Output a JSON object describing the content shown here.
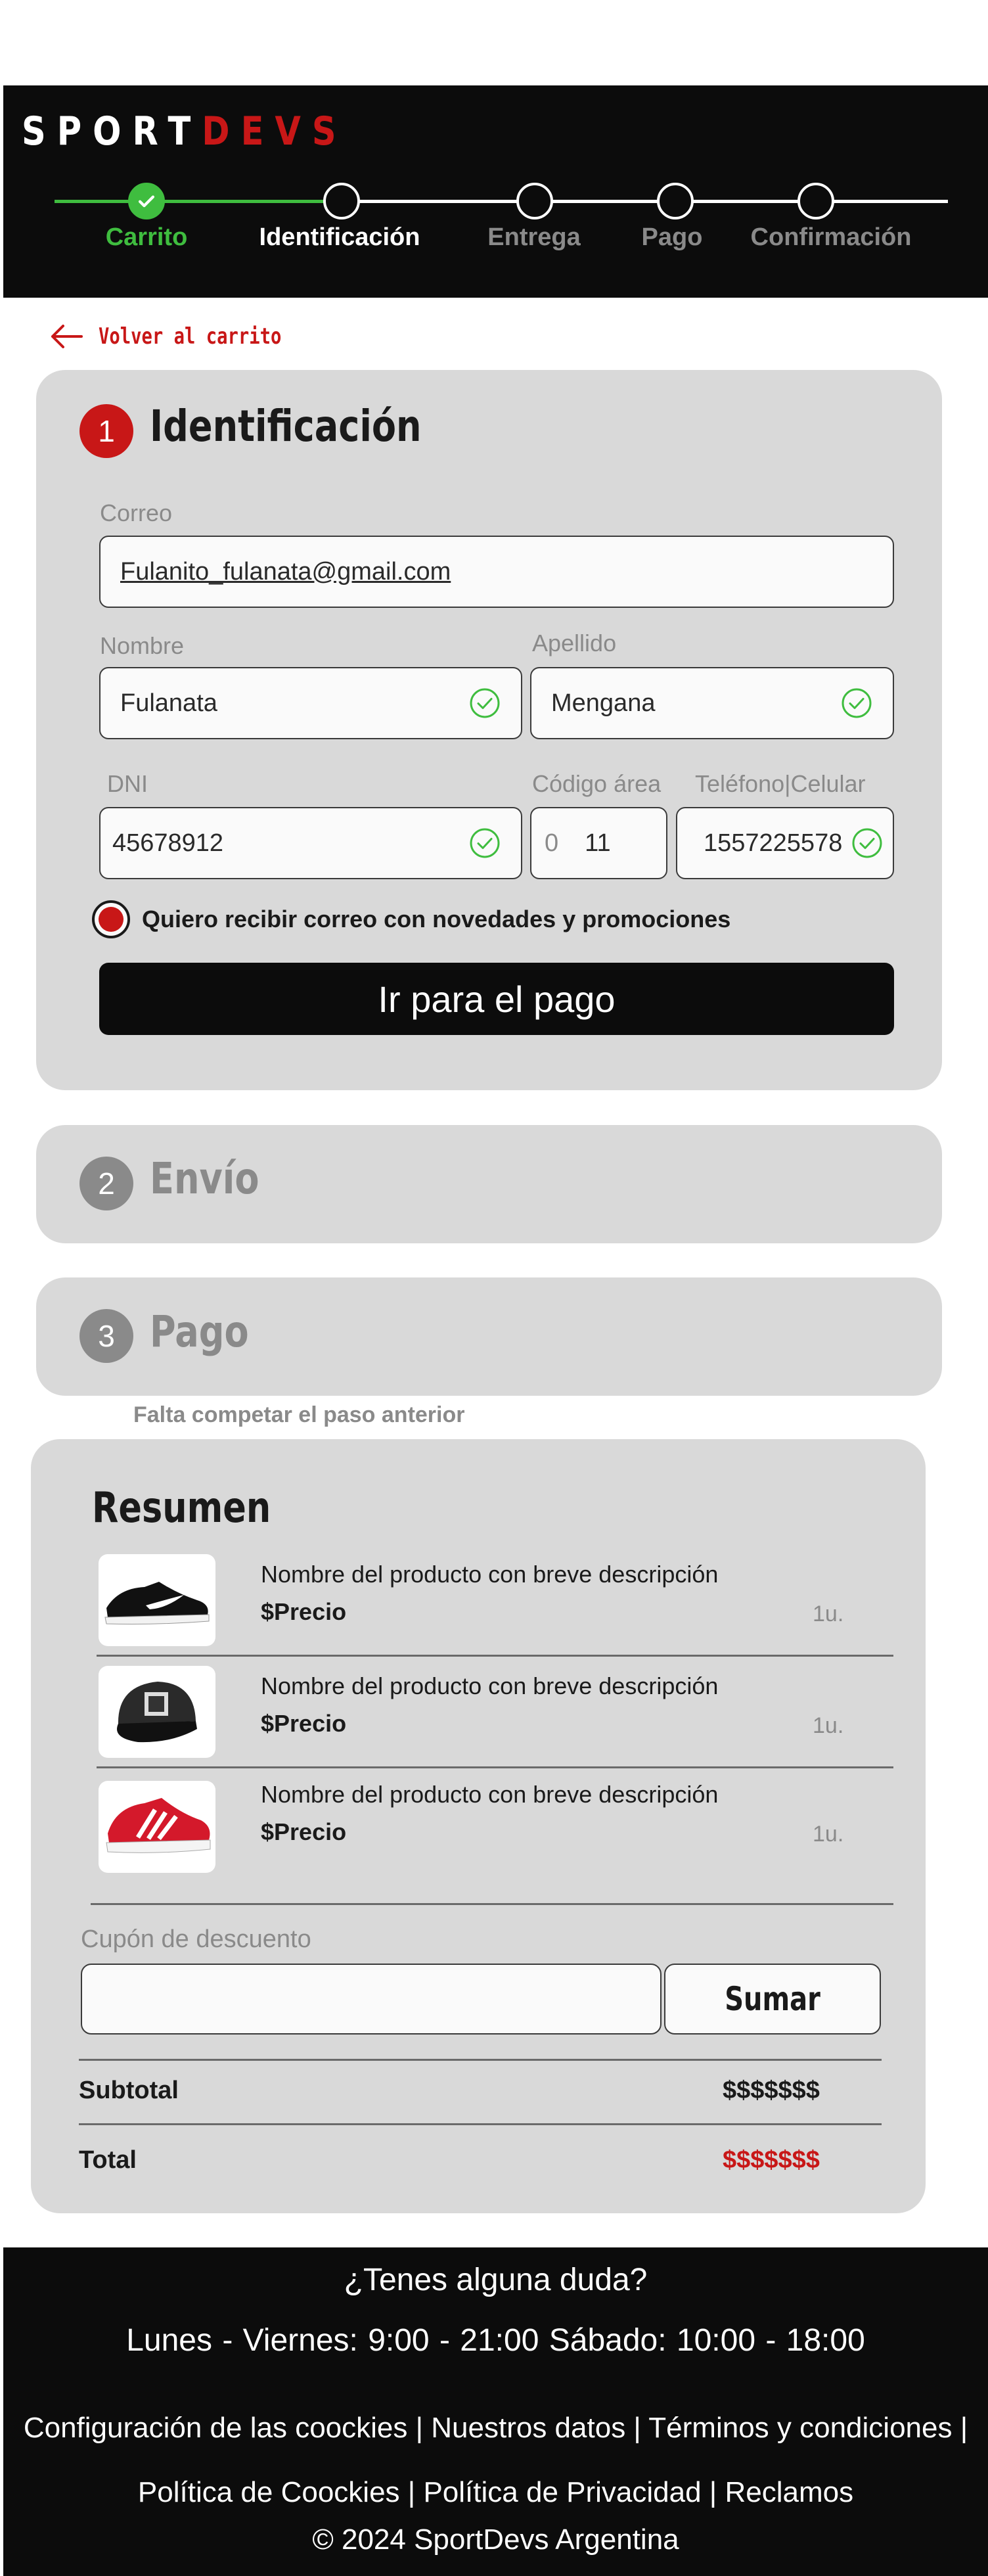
{
  "brand": {
    "part1": "SPORT",
    "part2": "DEVS"
  },
  "stepper": {
    "steps": [
      {
        "label": "Carrito",
        "state": "done"
      },
      {
        "label": "Identificación",
        "state": "current"
      },
      {
        "label": "Entrega",
        "state": "todo"
      },
      {
        "label": "Pago",
        "state": "todo"
      },
      {
        "label": "Confirmación",
        "state": "todo"
      }
    ]
  },
  "back_link": "Volver al carrito",
  "identificacion": {
    "number": "1",
    "title": "Identificación",
    "fields": {
      "correo": {
        "label": "Correo",
        "value": "Fulanito_fulanata@gmail.com"
      },
      "nombre": {
        "label": "Nombre",
        "value": "Fulanata"
      },
      "apellido": {
        "label": "Apellido",
        "value": "Mengana"
      },
      "dni": {
        "label": "DNI",
        "value": "45678912"
      },
      "codigo_area": {
        "label": "Código área",
        "prefix": "0",
        "value": "11"
      },
      "telefono": {
        "label": "Teléfono|Celular",
        "value": "1557225578"
      }
    },
    "newsletter_label": "Quiero recibir correo con novedades y promociones",
    "submit_label": "Ir para el pago"
  },
  "envio": {
    "number": "2",
    "title": "Envío"
  },
  "pago": {
    "number": "3",
    "title": "Pago",
    "hint": "Falta competar el paso anterior"
  },
  "resumen": {
    "title": "Resumen",
    "products": [
      {
        "name": "Nombre del producto con breve descripción",
        "price": "$Precio",
        "qty": "1u.",
        "image": "sneaker-black"
      },
      {
        "name": "Nombre del producto con breve descripción",
        "price": "$Precio",
        "qty": "1u.",
        "image": "cap-black"
      },
      {
        "name": "Nombre del producto con breve descripción",
        "price": "$Precio",
        "qty": "1u.",
        "image": "sneaker-red"
      }
    ],
    "coupon": {
      "label": "Cupón de descuento",
      "value": "",
      "button": "Sumar"
    },
    "subtotal": {
      "label": "Subtotal",
      "value": "$$$$$$$"
    },
    "total": {
      "label": "Total",
      "value": "$$$$$$$"
    }
  },
  "footer": {
    "question": "¿Tenes alguna duda?",
    "hours": "Lunes - Viernes: 9:00 - 21:00 Sábado: 10:00 - 18:00",
    "links": [
      "Configuración de las coockies",
      "Nuestros datos",
      "Términos y condiciones",
      "Política de Coockies",
      "Política de Privacidad",
      "Reclamos"
    ],
    "separator": " | ",
    "copyright": "©  2024  SportDevs Argentina"
  },
  "colors": {
    "accent_red": "#c81717",
    "success_green": "#3fbd3f",
    "dark": "#0c0c0c",
    "card_gray": "#d9d9d9",
    "muted_gray": "#8a8a8a"
  }
}
